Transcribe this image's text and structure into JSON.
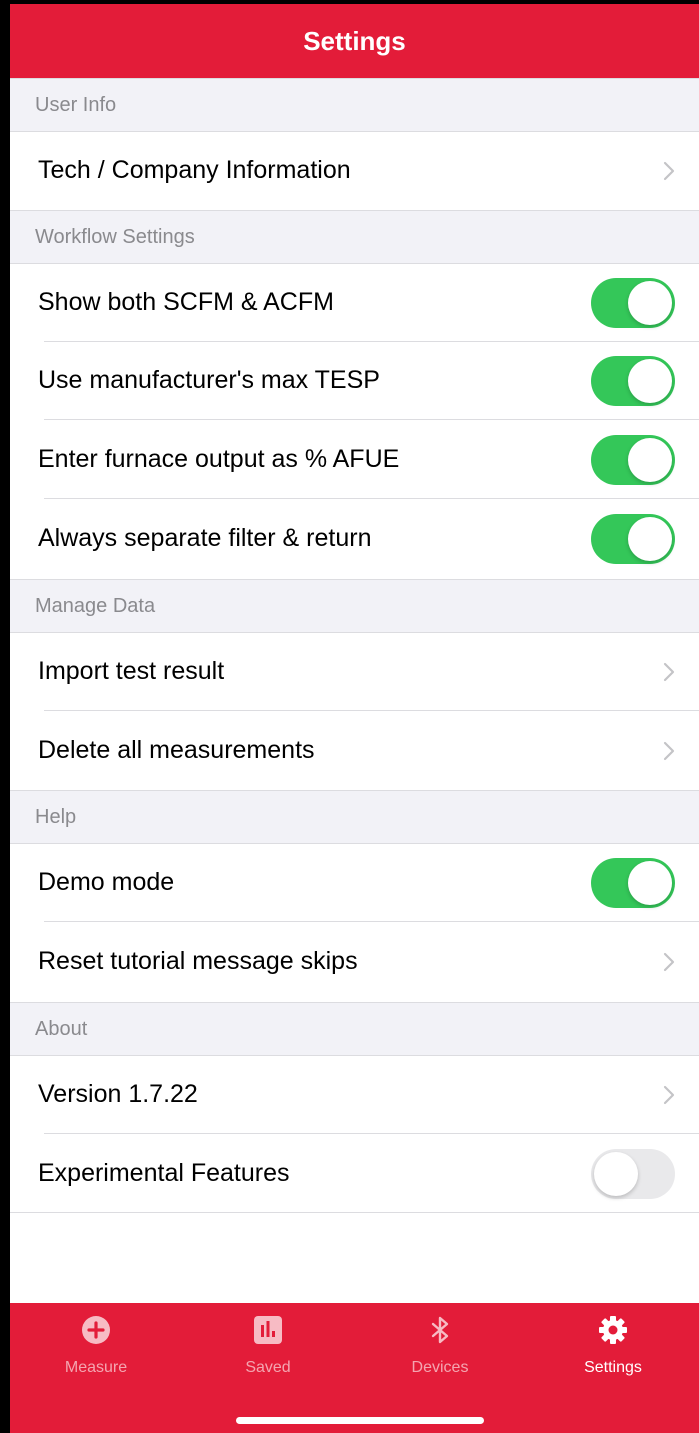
{
  "header": {
    "title": "Settings"
  },
  "sections": [
    {
      "title": "User Info"
    },
    {
      "title": "Workflow Settings"
    },
    {
      "title": "Manage Data"
    },
    {
      "title": "Help"
    },
    {
      "title": "About"
    }
  ],
  "rows": {
    "tech_company": {
      "label": "Tech / Company Information",
      "accessory": "chevron-right-icon"
    },
    "show_scfm_acfm": {
      "label": "Show both SCFM & ACFM",
      "on": true
    },
    "manufacturer_tesp": {
      "label": "Use manufacturer's max TESP",
      "on": true
    },
    "furnace_afue": {
      "label": "Enter furnace output as % AFUE",
      "on": true
    },
    "separate_filter": {
      "label": "Always separate filter & return",
      "on": true
    },
    "import_test": {
      "label": "Import test result",
      "accessory": "chevron-right-icon"
    },
    "delete_measurements": {
      "label": "Delete all measurements",
      "accessory": "chevron-right-icon"
    },
    "demo_mode": {
      "label": "Demo mode",
      "on": true
    },
    "reset_tutorial": {
      "label": "Reset tutorial message skips",
      "accessory": "chevron-right-icon"
    },
    "version": {
      "label": "Version 1.7.22",
      "accessory": "chevron-right-icon"
    },
    "experimental": {
      "label": "Experimental Features",
      "on": false
    }
  },
  "tabbar": {
    "tabs": [
      {
        "label": "Measure",
        "icon": "plus-circle-icon",
        "active": false
      },
      {
        "label": "Saved",
        "icon": "bar-chart-icon",
        "active": false
      },
      {
        "label": "Devices",
        "icon": "bluetooth-icon",
        "active": false
      },
      {
        "label": "Settings",
        "icon": "gear-icon",
        "active": true
      }
    ]
  },
  "colors": {
    "brand_red": "#e31c39",
    "toggle_on": "#34c759",
    "toggle_off": "#e9e9eb",
    "section_bg": "#f2f2f7",
    "section_text": "#8a8a8e"
  }
}
